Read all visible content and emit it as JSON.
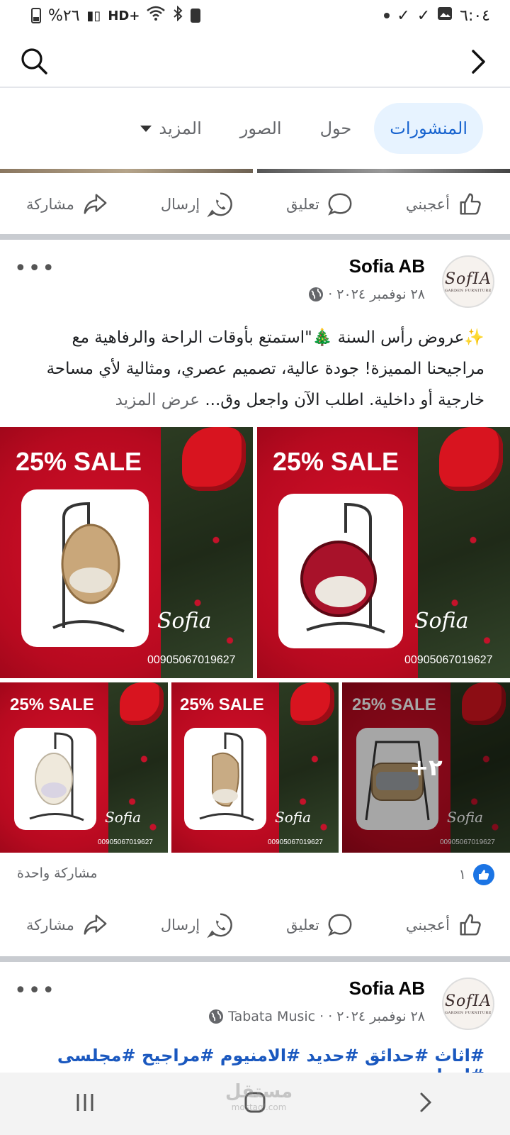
{
  "status_bar": {
    "time": "٦:٠٤",
    "battery": "%٢٦",
    "network": "HD+"
  },
  "tabs": [
    {
      "label": "المنشورات",
      "active": true
    },
    {
      "label": "حول"
    },
    {
      "label": "الصور"
    },
    {
      "label": "المزيد"
    }
  ],
  "actions": {
    "like": "أعجبني",
    "comment": "تعليق",
    "send": "إرسال",
    "share": "مشاركة"
  },
  "post1": {
    "avatar_logo": "SofIA",
    "avatar_sub": "GARDEN FURNITURE",
    "author": "Sofia AB",
    "date": "٢٨ نوفمبر ٢٠٢٤ ·",
    "text": "✨عروض رأس السنة 🎄\"استمتع بأوقات الراحة والرفاهية مع مراجيحنا المميزة! جودة عالية، تصميم عصري، ومثالية لأي مساحة خارجية أو داخلية. اطلب الآن واجعل وق...",
    "see_more": "عرض المزيد",
    "promo_sale": "25% SALE",
    "promo_brand": "Sofia",
    "promo_phone": "00905067019627",
    "more_images": "+٢",
    "like_count": "١",
    "shares": "مشاركة واحدة"
  },
  "post2": {
    "author": "Sofia AB",
    "date": "٢٨ نوفمبر ٢٠٢٤ ·",
    "music": "Tabata Music ·",
    "hashtags": "#اثاث #حدائق #حديد #الامنيوم #مراجيح #مجلسى #ليبيا"
  },
  "watermark": {
    "main": "مستقل",
    "sub": "mostaql.com"
  },
  "colors": {
    "accent": "#1763cf",
    "like_blue": "#1b74e4",
    "promo_red": "#c20d23"
  }
}
